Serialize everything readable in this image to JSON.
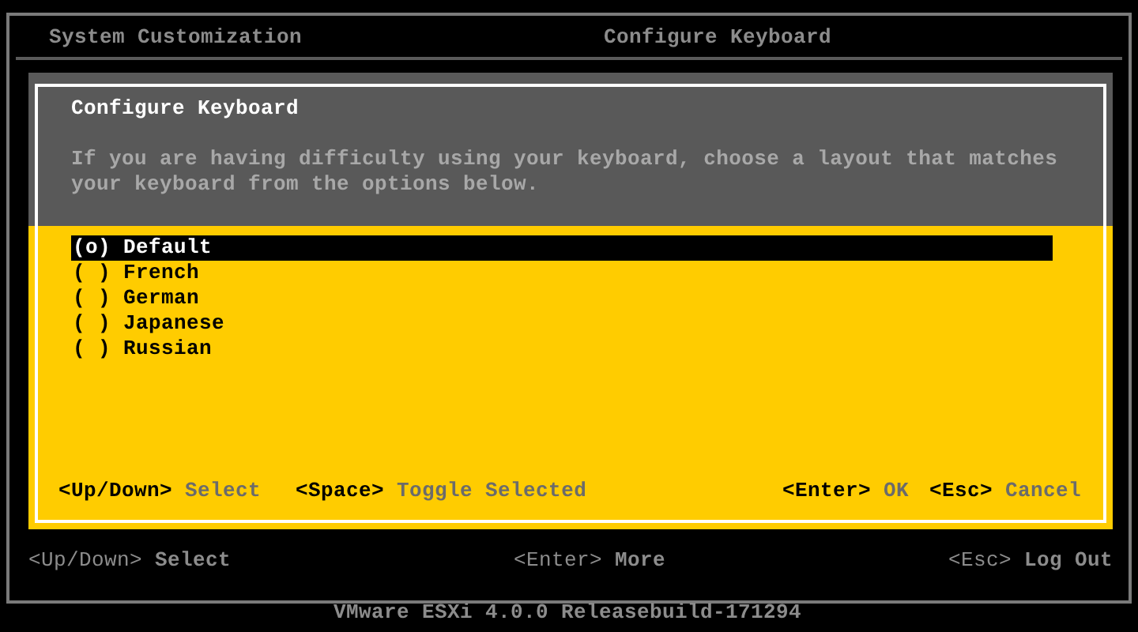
{
  "header": {
    "left_title": "System Customization",
    "right_title": "Configure Keyboard"
  },
  "dialog": {
    "title": "Configure Keyboard",
    "description": "If you are having difficulty using your keyboard, choose a layout that matches your keyboard from the options below.",
    "options": [
      {
        "radio": "(o)",
        "label": "Default",
        "selected": true
      },
      {
        "radio": "( )",
        "label": "French",
        "selected": false
      },
      {
        "radio": "( )",
        "label": "German",
        "selected": false
      },
      {
        "radio": "( )",
        "label": "Japanese",
        "selected": false
      },
      {
        "radio": "( )",
        "label": "Russian",
        "selected": false
      }
    ],
    "hints_left": [
      {
        "key": "<Up/Down>",
        "action": "Select"
      },
      {
        "key": "<Space>",
        "action": "Toggle Selected"
      }
    ],
    "hints_right": [
      {
        "key": "<Enter>",
        "action": "OK"
      },
      {
        "key": "<Esc>",
        "action": "Cancel"
      }
    ]
  },
  "footer": {
    "hints": [
      {
        "key": "<Up/Down>",
        "action": "Select"
      },
      {
        "key": "<Enter>",
        "action": "More"
      },
      {
        "key": "<Esc>",
        "action": "Log Out"
      }
    ]
  },
  "version": "VMware ESXi 4.0.0 Releasebuild-171294"
}
